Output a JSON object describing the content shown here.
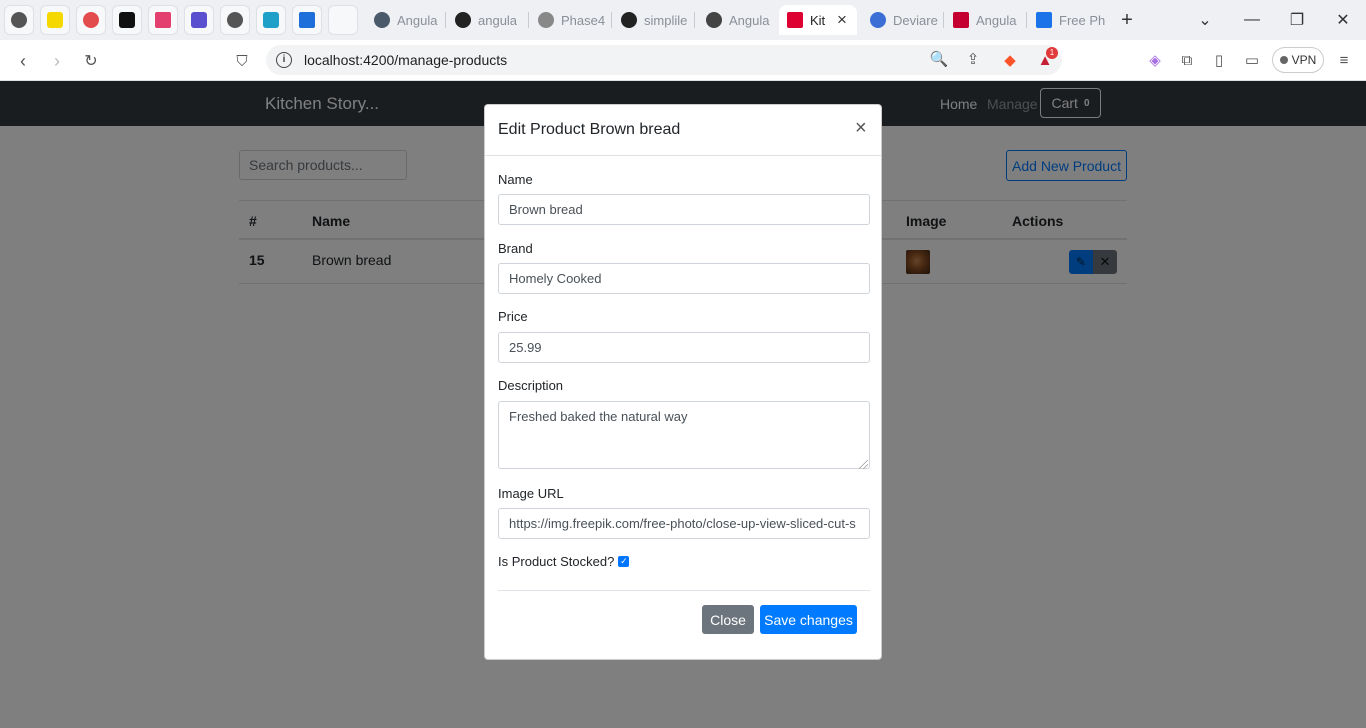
{
  "browser": {
    "tabs": [
      {
        "label": "Angula",
        "color": "#4a5a6a"
      },
      {
        "label": "angula",
        "color": "#222222"
      },
      {
        "label": "Phase4",
        "color": "#777777"
      },
      {
        "label": "simplile",
        "color": "#222222"
      },
      {
        "label": "Angula",
        "color": "#333333"
      },
      {
        "label": "Kit",
        "color": "#dd0031"
      },
      {
        "label": "Deviare",
        "color": "#3b6fd6"
      },
      {
        "label": "Angula",
        "color": "#c3002f"
      },
      {
        "label": "Free Ph",
        "color": "#1a73e8"
      }
    ],
    "active_tab_close": "×",
    "new_tab": "+",
    "url": "localhost:4200/manage-products",
    "brave_badge": "1",
    "vpn_label": "VPN"
  },
  "app": {
    "brand": "Kitchen Story...",
    "nav": {
      "home": "Home",
      "manage": "Manage",
      "cart": "Cart",
      "cart_count": "0"
    },
    "search_placeholder": "Search products...",
    "add_button": "Add New Product",
    "table": {
      "headers": {
        "id": "#",
        "name": "Name",
        "image": "Image",
        "actions": "Actions"
      },
      "rows": [
        {
          "id": "15",
          "name": "Brown bread"
        }
      ]
    }
  },
  "modal": {
    "title": "Edit Product Brown bread",
    "close_glyph": "×",
    "name_label": "Name",
    "name_value": "Brown bread",
    "brand_label": "Brand",
    "brand_value": "Homely Cooked",
    "price_label": "Price",
    "price_value": "25.99",
    "description_label": "Description",
    "description_value": "Freshed baked the natural way",
    "image_label": "Image URL",
    "image_value": "https://img.freepik.com/free-photo/close-up-view-sliced-cut-s",
    "stocked_label": "Is Product Stocked?",
    "stocked": true,
    "close_button": "Close",
    "save_button": "Save changes"
  },
  "colors": {
    "primary": "#007bff",
    "secondary": "#6c757d",
    "navbar": "#343a40"
  }
}
